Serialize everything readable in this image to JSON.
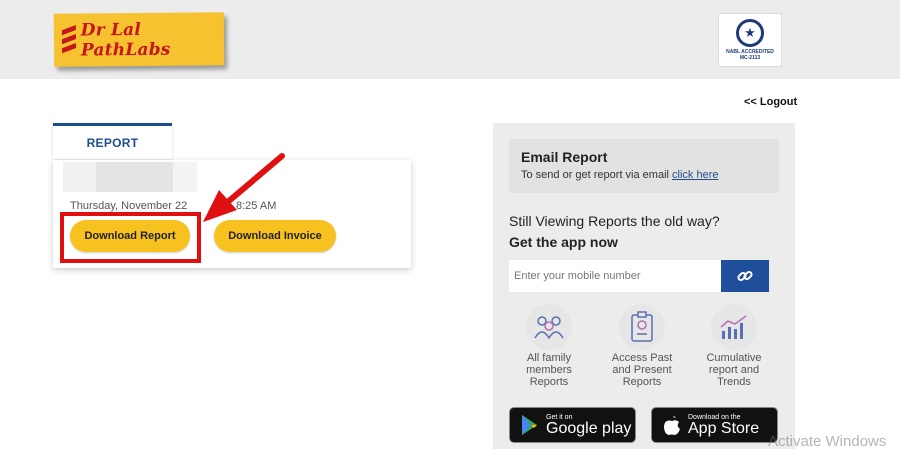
{
  "header": {
    "logo_text": "Dr Lal PathLabs",
    "nabl_text_1": "NABL ACCREDITED",
    "nabl_text_2": "MC-2113"
  },
  "nav": {
    "logout": "<< Logout"
  },
  "report_tab": {
    "label": "REPORT"
  },
  "report_card": {
    "date": "Thursday, November 22",
    "time": "8:25 AM",
    "download_report": "Download Report",
    "download_invoice": "Download Invoice"
  },
  "sidebar": {
    "email_title": "Email Report",
    "email_sub": "To send or get report via email",
    "email_link": "click here",
    "still_viewing": "Still Viewing Reports the old way?",
    "get_app": "Get the app now",
    "mobile_placeholder": "Enter your mobile number",
    "features": [
      {
        "label_1": "All family",
        "label_2": "members",
        "label_3": "Reports",
        "icon": "family-icon"
      },
      {
        "label_1": "Access Past",
        "label_2": "and Present",
        "label_3": "Reports",
        "icon": "report-icon"
      },
      {
        "label_1": "Cumulative",
        "label_2": "report and",
        "label_3": "Trends",
        "icon": "trend-icon"
      }
    ],
    "google_small": "Get it on",
    "google_big": "Google play",
    "apple_small": "Download on the",
    "apple_big": "App Store"
  },
  "os": {
    "watermark": "Activate Windows"
  },
  "colors": {
    "brand_yellow": "#f7c21f",
    "brand_red": "#c4161c",
    "brand_blue": "#1f4e8c",
    "highlight_red": "#e01010"
  }
}
